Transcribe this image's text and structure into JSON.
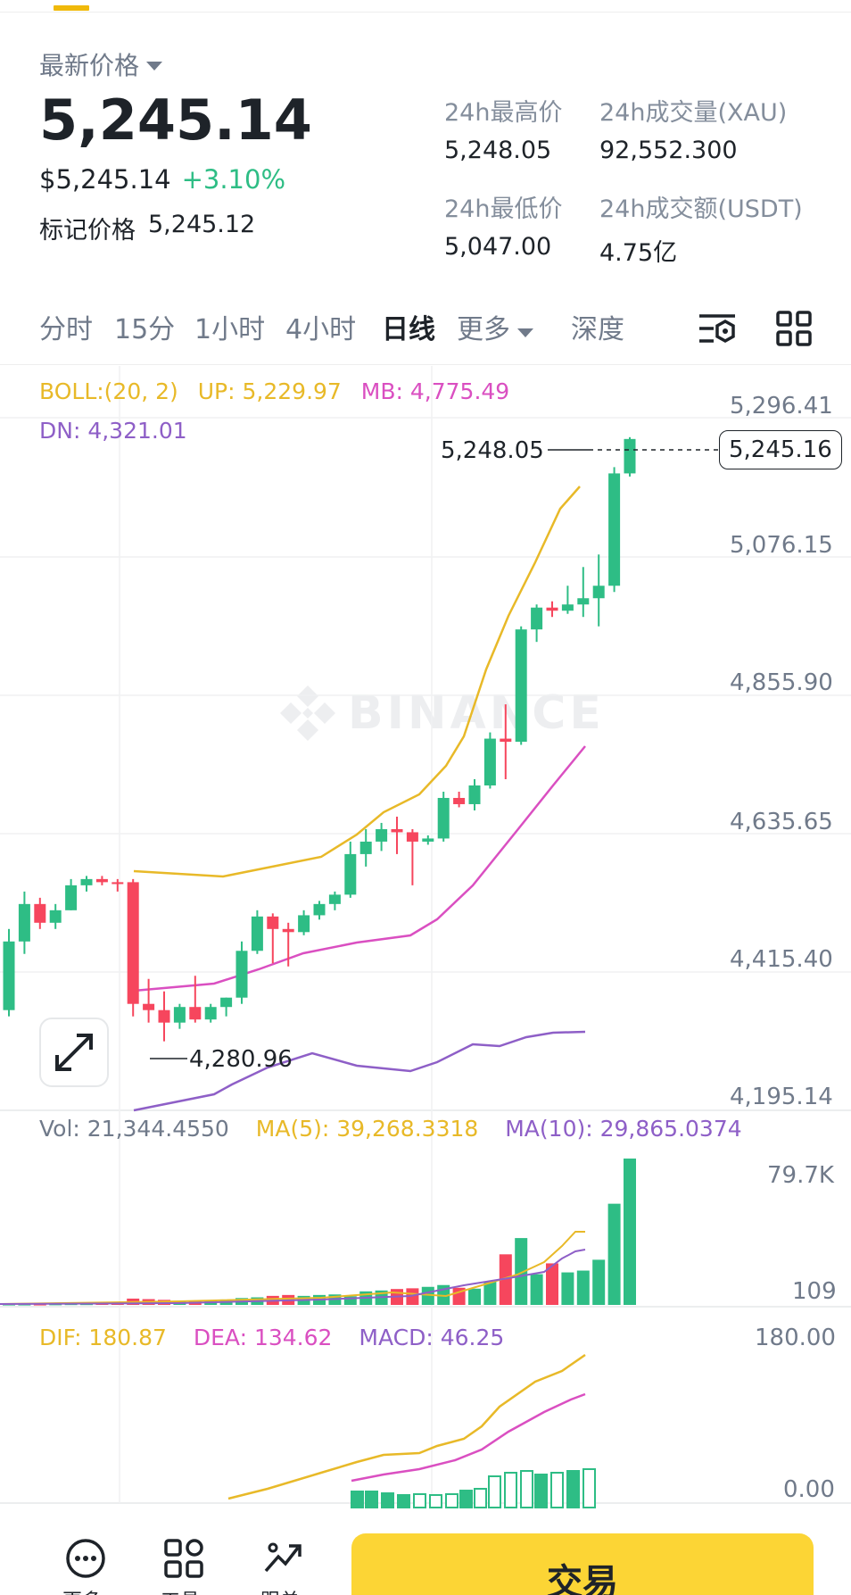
{
  "header": {
    "price_label": "最新价格",
    "last_price": "5,245.14",
    "usd_price": "$5,245.14",
    "change_pct": "+3.10%",
    "mark_label": "标记价格",
    "mark_price": "5,245.12"
  },
  "stats": {
    "high_label": "24h最高价",
    "high_value": "5,248.05",
    "volume_label": "24h成交量(XAU)",
    "volume_value": "92,552.300",
    "low_label": "24h最低价",
    "low_value": "5,047.00",
    "turnover_label": "24h成交额(USDT)",
    "turnover_value": "4.75亿"
  },
  "tabs": [
    {
      "label": "分时"
    },
    {
      "label": "15分"
    },
    {
      "label": "1小时"
    },
    {
      "label": "4小时"
    },
    {
      "label": "日线",
      "active": true
    },
    {
      "label": "更多"
    },
    {
      "label": "深度"
    }
  ],
  "tab_icons": [
    "chart-settings-icon",
    "layout-grid-icon"
  ],
  "boll_legend": {
    "boll": "BOLL:(20, 2)",
    "up": "UP: 5,229.97",
    "mb": "MB: 4,775.49",
    "dn": "DN: 4,321.01"
  },
  "price_axis": [
    "5,296.41",
    "5,076.15",
    "4,855.90",
    "4,635.65",
    "4,415.40",
    "4,195.14"
  ],
  "current_price_tag": "5,245.16",
  "high_marker": "5,248.05",
  "low_marker": "4,280.96",
  "vol_legend": {
    "vol": "Vol: 21,344.4550",
    "ma5": "MA(5): 39,268.3318",
    "ma10": "MA(10): 29,865.0374"
  },
  "vol_axis": [
    "79.7K",
    "109"
  ],
  "macd_legend": {
    "dif": "DIF: 180.87",
    "dea": "DEA: 134.62",
    "macd": "MACD: 46.25"
  },
  "macd_axis": [
    "180.00",
    "0.00"
  ],
  "watermark": "BINANCE",
  "bottom_nav": {
    "more_label": "更多",
    "tools_label": "工具",
    "copy_label": "跟单",
    "trade_label": "交易"
  },
  "colors": {
    "up": "#2ebd85",
    "down": "#f6465d",
    "boll_up": "#e8b928",
    "boll_mb": "#da4fc1",
    "boll_dn": "#8e5fc7",
    "accent": "#fcd535"
  },
  "chart_data": {
    "type": "candlestick",
    "price_range": [
      4195.14,
      5296.41
    ],
    "candles": [
      {
        "o": 4330,
        "h": 4460,
        "l": 4320,
        "c": 4440
      },
      {
        "o": 4440,
        "h": 4520,
        "l": 4420,
        "c": 4500
      },
      {
        "o": 4500,
        "h": 4510,
        "l": 4460,
        "c": 4470
      },
      {
        "o": 4470,
        "h": 4500,
        "l": 4460,
        "c": 4490
      },
      {
        "o": 4490,
        "h": 4540,
        "l": 4490,
        "c": 4530
      },
      {
        "o": 4530,
        "h": 4545,
        "l": 4520,
        "c": 4540
      },
      {
        "o": 4540,
        "h": 4545,
        "l": 4530,
        "c": 4535
      },
      {
        "o": 4535,
        "h": 4540,
        "l": 4520,
        "c": 4532
      },
      {
        "o": 4535,
        "h": 4540,
        "l": 4320,
        "c": 4340
      },
      {
        "o": 4340,
        "h": 4380,
        "l": 4310,
        "c": 4330
      },
      {
        "o": 4330,
        "h": 4360,
        "l": 4280,
        "c": 4310
      },
      {
        "o": 4310,
        "h": 4340,
        "l": 4300,
        "c": 4335
      },
      {
        "o": 4335,
        "h": 4385,
        "l": 4310,
        "c": 4315
      },
      {
        "o": 4315,
        "h": 4340,
        "l": 4310,
        "c": 4335
      },
      {
        "o": 4335,
        "h": 4350,
        "l": 4320,
        "c": 4350
      },
      {
        "o": 4350,
        "h": 4440,
        "l": 4340,
        "c": 4425
      },
      {
        "o": 4425,
        "h": 4490,
        "l": 4420,
        "c": 4480
      },
      {
        "o": 4480,
        "h": 4485,
        "l": 4405,
        "c": 4460
      },
      {
        "o": 4460,
        "h": 4470,
        "l": 4400,
        "c": 4455
      },
      {
        "o": 4455,
        "h": 4490,
        "l": 4450,
        "c": 4482
      },
      {
        "o": 4482,
        "h": 4505,
        "l": 4475,
        "c": 4500
      },
      {
        "o": 4500,
        "h": 4520,
        "l": 4490,
        "c": 4515
      },
      {
        "o": 4515,
        "h": 4600,
        "l": 4510,
        "c": 4580
      },
      {
        "o": 4580,
        "h": 4620,
        "l": 4560,
        "c": 4600
      },
      {
        "o": 4600,
        "h": 4630,
        "l": 4585,
        "c": 4620
      },
      {
        "o": 4620,
        "h": 4640,
        "l": 4580,
        "c": 4615
      },
      {
        "o": 4615,
        "h": 4620,
        "l": 4530,
        "c": 4600
      },
      {
        "o": 4600,
        "h": 4610,
        "l": 4595,
        "c": 4605
      },
      {
        "o": 4605,
        "h": 4680,
        "l": 4600,
        "c": 4670
      },
      {
        "o": 4670,
        "h": 4680,
        "l": 4655,
        "c": 4660
      },
      {
        "o": 4660,
        "h": 4700,
        "l": 4650,
        "c": 4690
      },
      {
        "o": 4690,
        "h": 4775,
        "l": 4685,
        "c": 4765
      },
      {
        "o": 4765,
        "h": 4820,
        "l": 4700,
        "c": 4760
      },
      {
        "o": 4760,
        "h": 4945,
        "l": 4755,
        "c": 4940
      },
      {
        "o": 4940,
        "h": 4980,
        "l": 4920,
        "c": 4975
      },
      {
        "o": 4975,
        "h": 4985,
        "l": 4960,
        "c": 4970
      },
      {
        "o": 4970,
        "h": 5010,
        "l": 4965,
        "c": 4980
      },
      {
        "o": 4980,
        "h": 5040,
        "l": 4960,
        "c": 4990
      },
      {
        "o": 4990,
        "h": 5060,
        "l": 4945,
        "c": 5010
      },
      {
        "o": 5010,
        "h": 5200,
        "l": 5000,
        "c": 5190
      },
      {
        "o": 5190,
        "h": 5248.05,
        "l": 5185,
        "c": 5245.16
      }
    ],
    "volume": {
      "range": [
        0,
        82000
      ],
      "values": [
        700,
        700,
        700,
        800,
        900,
        900,
        1000,
        1000,
        3500,
        3200,
        2800,
        2200,
        2000,
        2500,
        3000,
        3800,
        4200,
        5000,
        5500,
        5000,
        5500,
        5800,
        4800,
        7500,
        8000,
        8800,
        9200,
        10000,
        11000,
        9500,
        9000,
        13000,
        28000,
        37000,
        17000,
        23000,
        18000,
        19000,
        25000,
        56000,
        81000
      ]
    },
    "macd": {
      "range": [
        -10,
        190
      ]
    }
  }
}
